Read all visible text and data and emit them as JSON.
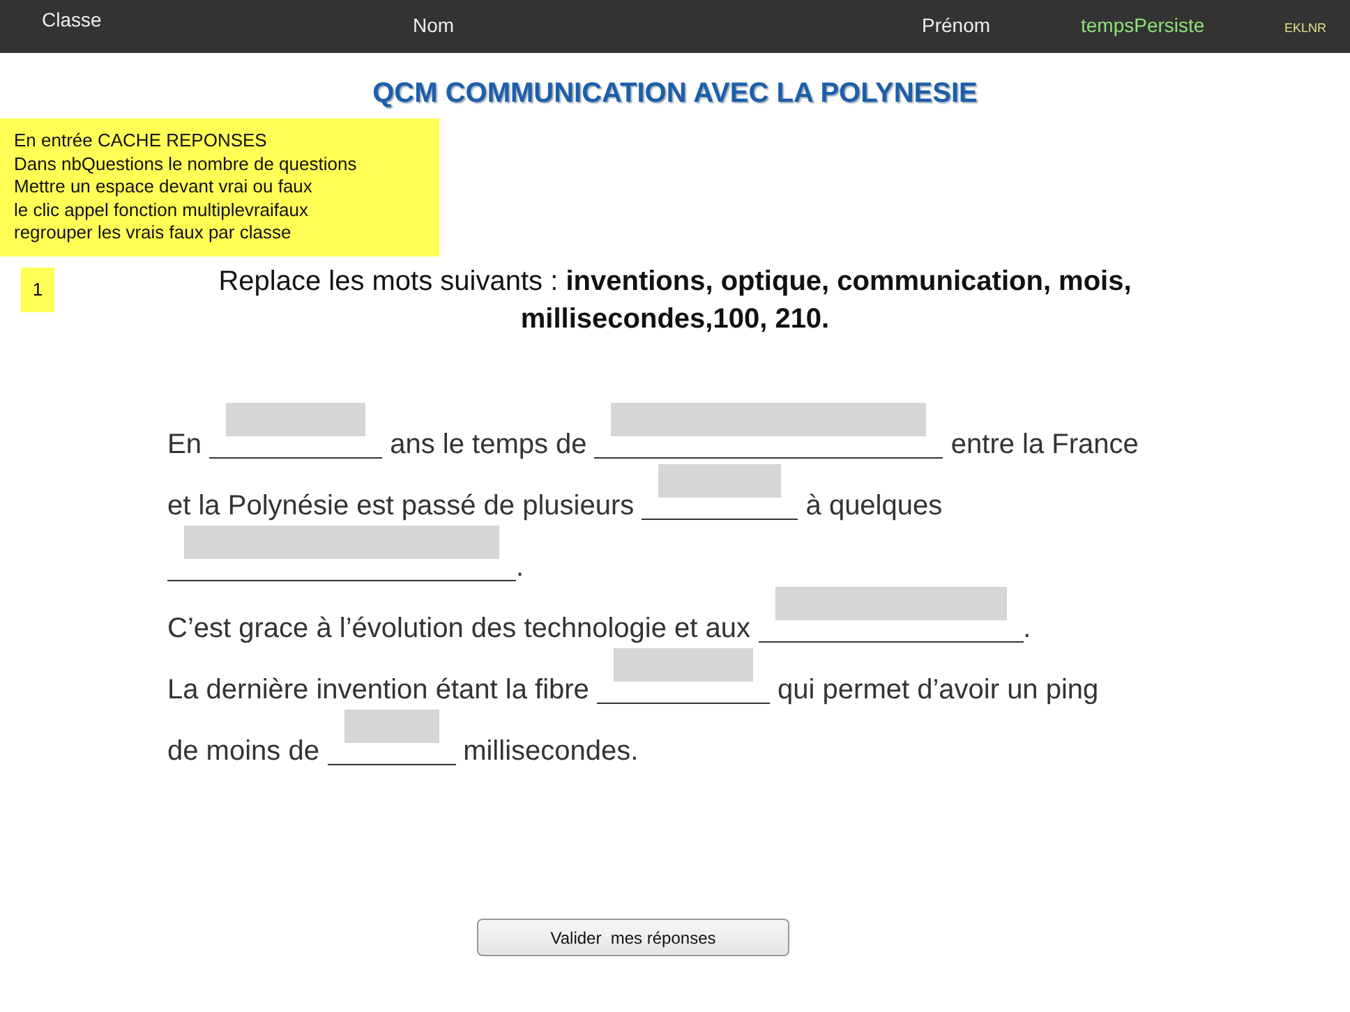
{
  "header": [
    {
      "label": "Classe",
      "kind": "plain"
    },
    {
      "label": "Nom",
      "kind": "plain"
    },
    {
      "label": "Prénom",
      "kind": "plain"
    },
    {
      "label": "tempsPersiste",
      "kind": "green"
    },
    {
      "label": "EKLNR",
      "kind": "small"
    }
  ],
  "title": "QCM COMMUNICATION AVEC LA POLYNESIE",
  "note": [
    "En entrée CACHE REPONSES",
    "Dans nbQuestions le nombre de questions",
    "Mettre un espace devant vrai ou faux",
    "le clic appel fonction multiplevraifaux",
    "regrouper les vrais faux par classe"
  ],
  "question_number": "1",
  "instruction": "Replace les mots suivants : **inventions, optique, communication, mois, millisecondes,100, 210.**",
  "lines": [
    [
      {
        "kind": "text",
        "text": "En "
      },
      {
        "kind": "blank"
      },
      {
        "kind": "text",
        "text": " ans le temps de "
      },
      {
        "kind": "blank"
      },
      {
        "kind": "text",
        "text": " entre la France"
      }
    ],
    [
      {
        "kind": "text",
        "text": "et la Polynésie est passé de plusieurs "
      },
      {
        "kind": "blank"
      },
      {
        "kind": "text",
        "text": " à quelques"
      }
    ],
    [
      {
        "kind": "blank"
      },
      {
        "kind": "text",
        "text": "."
      }
    ],
    [
      {
        "kind": "text",
        "text": "C’est grace à l’évolution des technologie et aux "
      },
      {
        "kind": "blank"
      },
      {
        "kind": "text",
        "text": "."
      }
    ],
    [
      {
        "kind": "text",
        "text": "La dernière invention étant la fibre "
      },
      {
        "kind": "blank"
      },
      {
        "kind": "text",
        "text": " qui permet d’avoir un ping"
      }
    ],
    [
      {
        "kind": "text",
        "text": "de moins de "
      },
      {
        "kind": "blank"
      },
      {
        "kind": "text",
        "text": " millisecondes."
      }
    ]
  ],
  "submit_button": "Valider  mes réponses"
}
